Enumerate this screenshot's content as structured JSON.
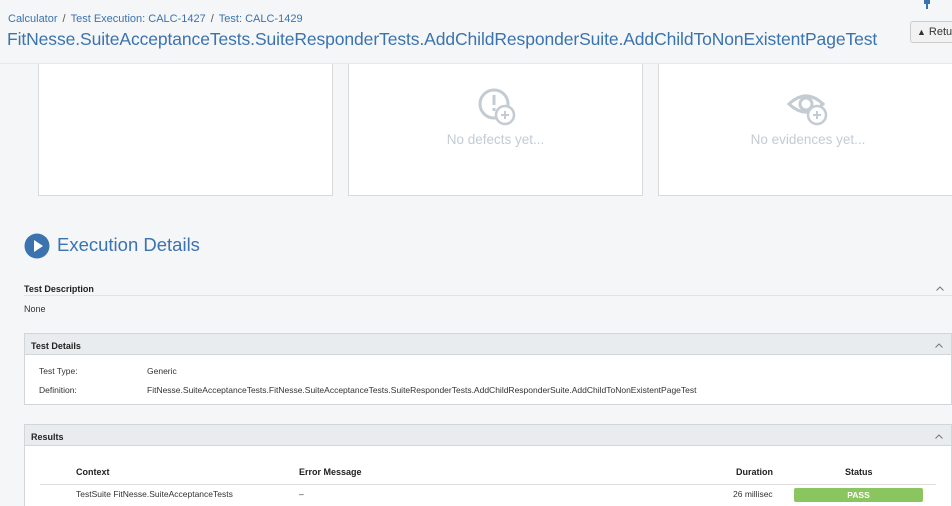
{
  "header": {
    "breadcrumb": [
      {
        "label": "Calculator"
      },
      {
        "label": "Test Execution: CALC-1427"
      },
      {
        "label": "Test: CALC-1429"
      }
    ],
    "title": "FitNesse.SuiteAcceptanceTests.SuiteResponderTests.AddChildResponderSuite.AddChildToNonExistentPageTest",
    "return_label": "Retu"
  },
  "panels": {
    "defects_empty": "No defects yet...",
    "evidences_empty": "No evidences yet..."
  },
  "execution": {
    "title": "Execution Details",
    "description_header": "Test Description",
    "description_value": "None",
    "details_header": "Test Details",
    "test_type_label": "Test Type:",
    "test_type_value": "Generic",
    "definition_label": "Definition:",
    "definition_value": "FitNesse.SuiteAcceptanceTests.FitNesse.SuiteAcceptanceTests.SuiteResponderTests.AddChildResponderSuite.AddChildToNonExistentPageTest",
    "results_header": "Results"
  },
  "results": {
    "columns": {
      "context": "Context",
      "error": "Error Message",
      "duration": "Duration",
      "status": "Status"
    },
    "rows": [
      {
        "context": "TestSuite FitNesse.SuiteAcceptanceTests",
        "error": "–",
        "duration": "26 millisec",
        "status": "PASS"
      }
    ]
  },
  "colors": {
    "link": "#3b73af",
    "pass": "#8bc55f",
    "placeholder": "#c3cbd3"
  }
}
